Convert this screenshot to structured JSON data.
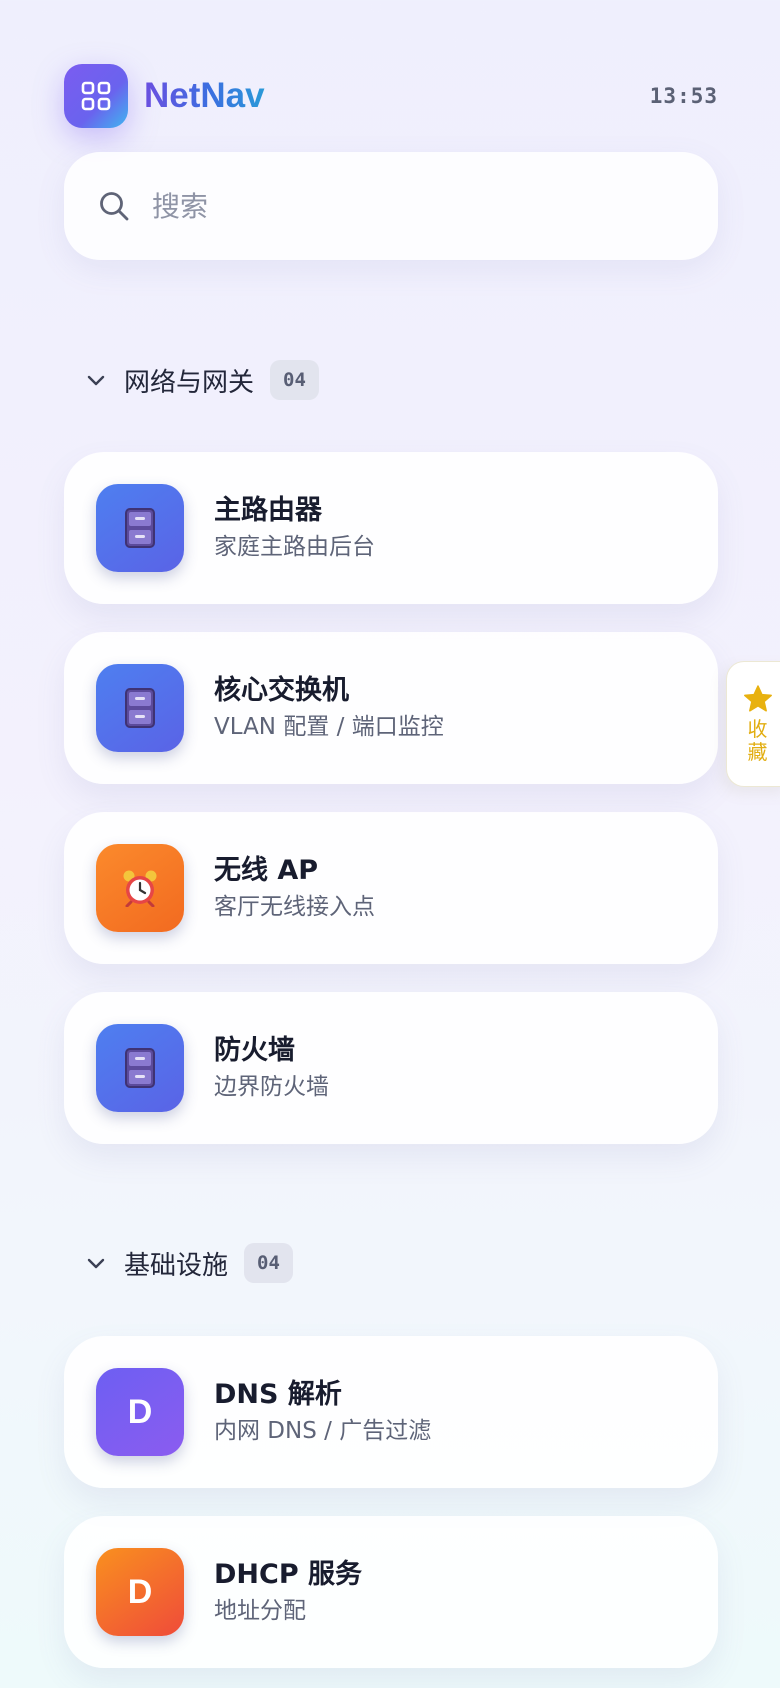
{
  "app": {
    "title": "NetNav",
    "time": "13:53"
  },
  "search": {
    "placeholder": "搜索",
    "value": ""
  },
  "sections": [
    {
      "title": "网络与网关",
      "count": "04",
      "items": [
        {
          "title": "主路由器",
          "subtitle": "家庭主路由后台",
          "icon": "file-cabinet-icon",
          "color": "#5270ec"
        },
        {
          "title": "核心交换机",
          "subtitle": "VLAN 配置 / 端口监控",
          "icon": "file-cabinet-icon",
          "color": "#5270ec"
        },
        {
          "title": "无线 AP",
          "subtitle": "客厅无线接入点",
          "icon": "alarm-clock-icon",
          "color": "#f57a25"
        },
        {
          "title": "防火墙",
          "subtitle": "边界防火墙",
          "icon": "file-cabinet-icon",
          "color": "#5270ec"
        }
      ]
    },
    {
      "title": "基础设施",
      "count": "04",
      "items": [
        {
          "title": "DNS 解析",
          "subtitle": "内网 DNS / 广告过滤",
          "letter": "D",
          "color": "#7a5df1"
        },
        {
          "title": "DHCP 服务",
          "subtitle": "地址分配",
          "letter": "D",
          "color": "#f46a2e"
        }
      ]
    }
  ],
  "favorites": {
    "label": "收藏",
    "color": "#e8b10f"
  }
}
